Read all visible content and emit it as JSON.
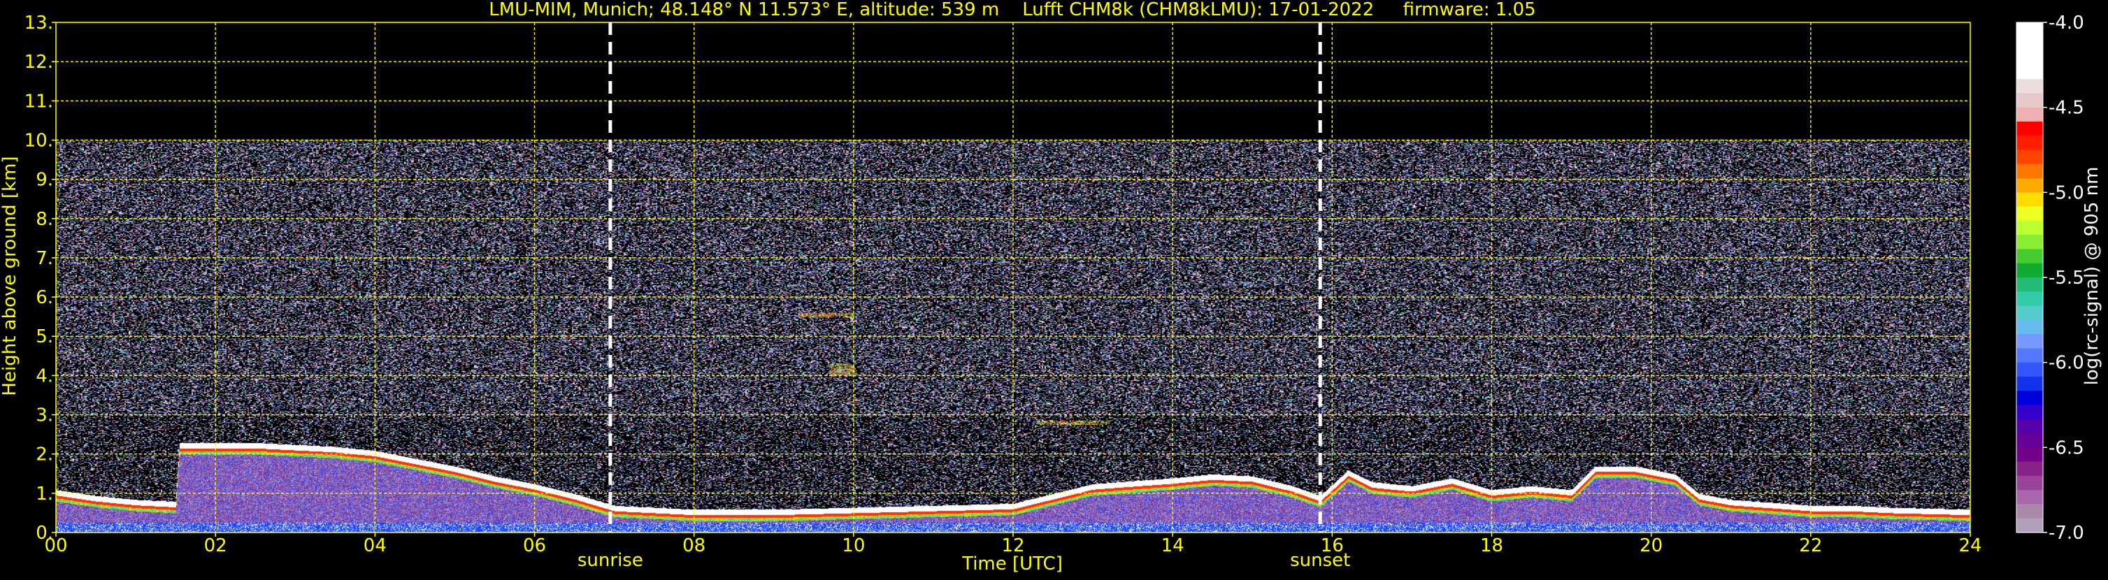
{
  "chart_data": {
    "type": "heatmap",
    "title": "LMU-MIM, Munich; 48.148° N 11.573° E, altitude: 539 m    Lufft CHM8k (CHM8kLMU): 17-01-2022     firmware: 1.05",
    "xlabel": "Time [UTC]",
    "ylabel": "Height above ground [km]",
    "xlim": [
      0,
      24
    ],
    "ylim": [
      0,
      13
    ],
    "x_ticks": [
      "00",
      "02",
      "04",
      "06",
      "08",
      "10",
      "12",
      "14",
      "16",
      "18",
      "20",
      "22",
      "24"
    ],
    "y_ticks": [
      "0.",
      "1.",
      "2.",
      "3.",
      "4.",
      "5.",
      "6.",
      "7.",
      "8.",
      "9.",
      "10.",
      "11.",
      "12.",
      "13."
    ],
    "grid": true,
    "grid_color": "#ffff00",
    "background_color": "#000000",
    "data_max_height_km": 10,
    "events": [
      {
        "label": "sunrise",
        "time_h": 6.95
      },
      {
        "label": "sunset",
        "time_h": 15.85
      }
    ],
    "colorbar": {
      "label": "log(rc-signal) @ 905 nm",
      "range": [
        -7.0,
        -4.0
      ],
      "ticks": [
        "-4.0",
        "-4.5",
        "-5.0",
        "-5.5",
        "-6.0",
        "-6.5",
        "-7.0"
      ],
      "colors": [
        "#ffffff",
        "#ffffff",
        "#ffffff",
        "#ffffff",
        "#eedddd",
        "#e8c8c8",
        "#eeb0b0",
        "#ff0000",
        "#ff2000",
        "#ff4400",
        "#ff7700",
        "#ffaa00",
        "#ffdd00",
        "#eeff22",
        "#bbff33",
        "#88ee33",
        "#44cc33",
        "#11aa33",
        "#22bb77",
        "#33ccaa",
        "#55cccc",
        "#66bbee",
        "#7799ff",
        "#5577ff",
        "#3355ff",
        "#1133ee",
        "#0000dd",
        "#3300cc",
        "#5500aa",
        "#660099",
        "#770088",
        "#882288",
        "#994499",
        "#aa66aa",
        "#aa88aa",
        "#b0a0b8"
      ]
    },
    "boundary_layer_top_km": [
      [
        0.0,
        1.0
      ],
      [
        0.5,
        0.85
      ],
      [
        1.0,
        0.75
      ],
      [
        1.5,
        0.7
      ],
      [
        1.55,
        2.2
      ],
      [
        2.0,
        2.2
      ],
      [
        2.5,
        2.2
      ],
      [
        3.0,
        2.15
      ],
      [
        3.5,
        2.1
      ],
      [
        4.0,
        2.0
      ],
      [
        4.5,
        1.8
      ],
      [
        5.0,
        1.6
      ],
      [
        5.5,
        1.35
      ],
      [
        6.0,
        1.15
      ],
      [
        6.5,
        0.9
      ],
      [
        7.0,
        0.6
      ],
      [
        7.5,
        0.55
      ],
      [
        8.0,
        0.5
      ],
      [
        9.0,
        0.5
      ],
      [
        10.0,
        0.55
      ],
      [
        11.0,
        0.6
      ],
      [
        12.0,
        0.65
      ],
      [
        13.0,
        1.15
      ],
      [
        14.0,
        1.3
      ],
      [
        14.5,
        1.4
      ],
      [
        15.0,
        1.35
      ],
      [
        15.5,
        1.1
      ],
      [
        15.85,
        0.85
      ],
      [
        16.2,
        1.5
      ],
      [
        16.5,
        1.2
      ],
      [
        17.0,
        1.1
      ],
      [
        17.5,
        1.3
      ],
      [
        18.0,
        1.0
      ],
      [
        18.5,
        1.1
      ],
      [
        19.0,
        1.0
      ],
      [
        19.3,
        1.6
      ],
      [
        19.8,
        1.6
      ],
      [
        20.3,
        1.4
      ],
      [
        20.6,
        0.9
      ],
      [
        21.0,
        0.75
      ],
      [
        22.0,
        0.6
      ],
      [
        22.5,
        0.6
      ],
      [
        23.0,
        0.55
      ],
      [
        24.0,
        0.5
      ]
    ],
    "cloud_features": [
      {
        "time_h": [
          9.3,
          10.0
        ],
        "height_km": [
          5.5,
          5.6
        ]
      },
      {
        "time_h": [
          9.7,
          10.0
        ],
        "height_km": [
          4.0,
          4.3
        ]
      },
      {
        "time_h": [
          12.3,
          13.2
        ],
        "height_km": [
          2.75,
          2.85
        ]
      }
    ]
  }
}
